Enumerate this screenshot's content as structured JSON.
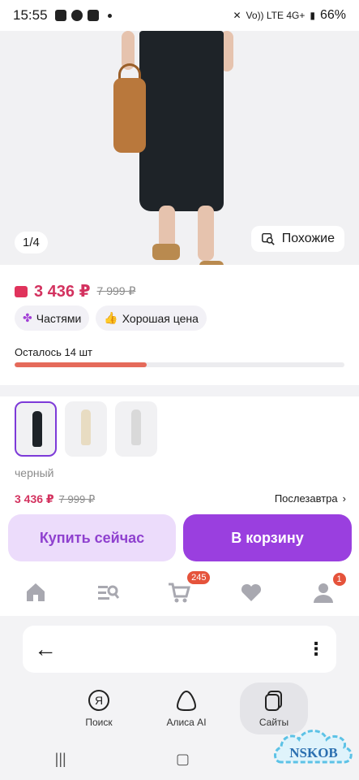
{
  "status_bar": {
    "time": "15:55",
    "network": "Vo)) LTE 4G+",
    "battery": "66%"
  },
  "gallery": {
    "counter": "1/4",
    "similar_label": "Похожие"
  },
  "price": {
    "current": "3 436 ₽",
    "old": "7 999 ₽"
  },
  "chips": [
    {
      "label": "Частями",
      "icon": "flower-icon"
    },
    {
      "label": "Хорошая цена",
      "icon": "thumbs-up-icon"
    }
  ],
  "stock": {
    "label": "Осталось 14 шт",
    "progress_fraction": 0.4
  },
  "variants": {
    "color_label": "черный",
    "thumbs": [
      {
        "color": "#1e2328",
        "selected": true
      },
      {
        "color": "#e8dcc2",
        "selected": false
      },
      {
        "color": "#d9d9d9",
        "selected": false
      }
    ]
  },
  "buy_bar": {
    "price": "3 436 ₽",
    "old_price": "7 999 ₽",
    "delivery": "Послезавтра",
    "buy_now": "Купить сейчас",
    "add_to_cart": "В корзину"
  },
  "tabbar": {
    "cart_badge": "245",
    "profile_badge": "1"
  },
  "browser": {
    "nav": [
      {
        "label": "Поиск",
        "icon": "yandex-icon"
      },
      {
        "label": "Алиса AI",
        "icon": "alice-icon"
      },
      {
        "label": "Сайты",
        "icon": "tabs-icon"
      }
    ]
  },
  "watermark": "NSKOB",
  "colors": {
    "accent": "#9a3fdf",
    "price": "#d3325f",
    "progress": "#e56a5a"
  }
}
